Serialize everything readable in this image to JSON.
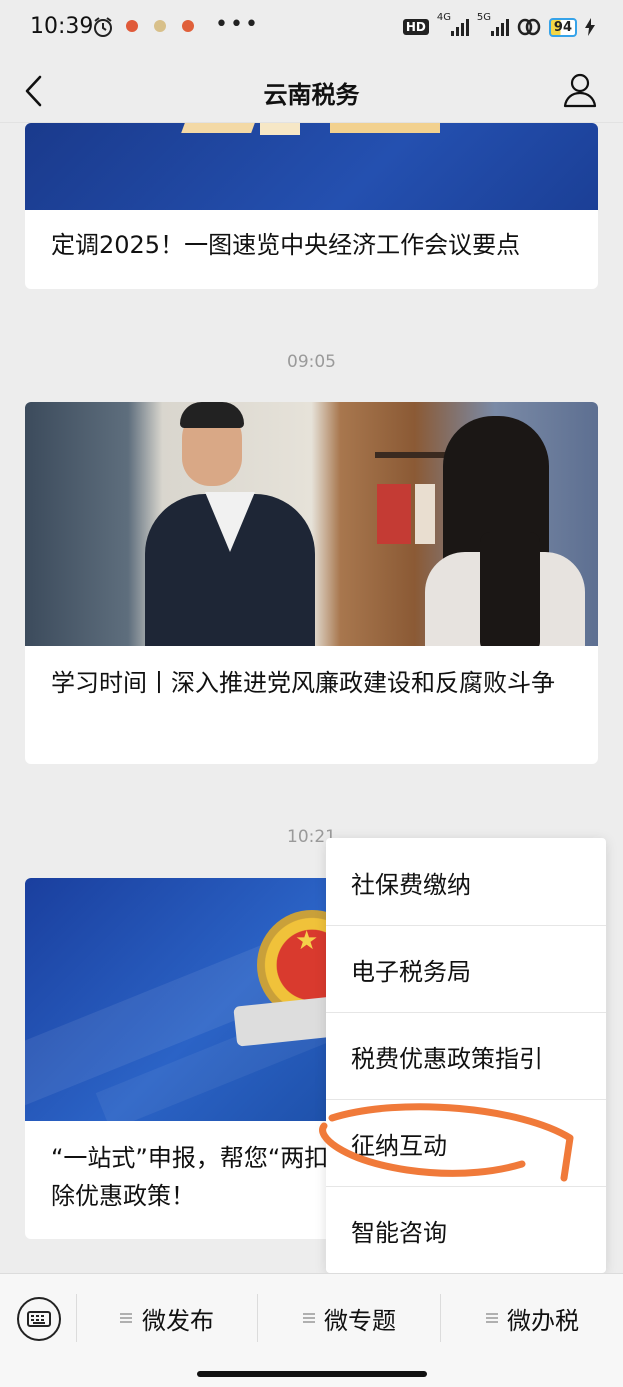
{
  "status_bar": {
    "time": "10:39",
    "hd": "HD",
    "net1": "4G",
    "net2": "5G",
    "battery": "94"
  },
  "header": {
    "title": "云南税务"
  },
  "articles": [
    {
      "timestamp": "",
      "title": "定调2025！一图速览中央经济工作会议要点"
    },
    {
      "timestamp": "09:05",
      "title": "学习时间丨深入推进党风廉政建设和反腐败斗争"
    },
    {
      "timestamp": "10:21",
      "title": "“一站式”申报，帮您“两扣除优惠政策！"
    }
  ],
  "menu": {
    "items": [
      {
        "label": "社保费缴纳"
      },
      {
        "label": "电子税务局"
      },
      {
        "label": "税费优惠政策指引"
      },
      {
        "label": "征纳互动"
      },
      {
        "label": "智能咨询"
      }
    ]
  },
  "bottom_tabs": [
    {
      "label": "微发布"
    },
    {
      "label": "微专题"
    },
    {
      "label": "微办税"
    }
  ],
  "colors": {
    "annotation": "#f07a3a",
    "banner_blue": "#1d4fa8"
  }
}
